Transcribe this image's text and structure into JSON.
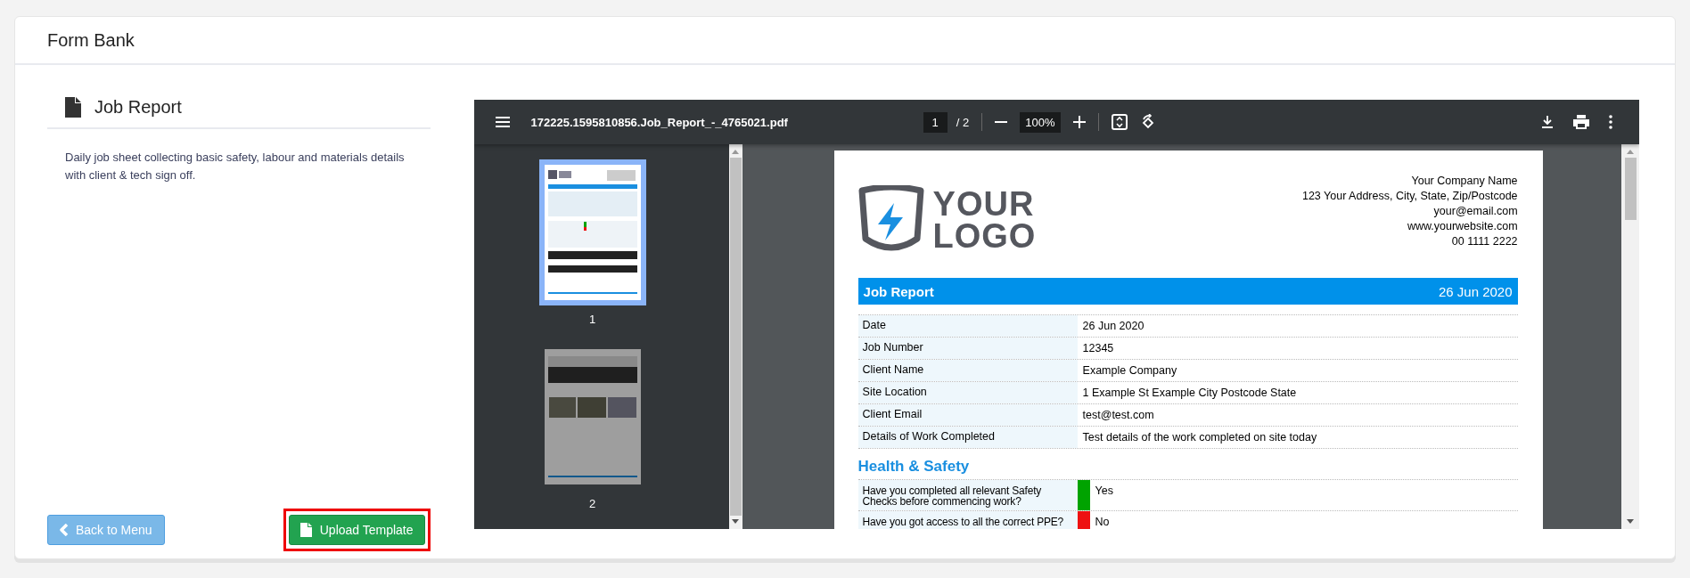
{
  "header": {
    "title": "Form Bank"
  },
  "form": {
    "title": "Job Report",
    "description": "Daily job sheet collecting basic safety, labour and materials details with client & tech sign off.",
    "back_button": "Back to Menu",
    "upload_button": {
      "label": "Upload Template",
      "highlighted": true
    }
  },
  "viewer": {
    "file_name": "172225.1595810856.Job_Report_-_4765021.pdf",
    "page_input": "1",
    "page_count": "/ 2",
    "zoom": "100%",
    "thumbnails": [
      {
        "label": "1",
        "selected": true
      },
      {
        "label": "2",
        "selected": false
      }
    ],
    "document": {
      "logo": {
        "line_1": "YOUR",
        "line_2": "LOGO"
      },
      "company_lines": [
        "Your Company Name",
        "123 Your Address, City, State, Zip/Postcode",
        "your@email.com",
        "www.yourwebsite.com",
        "00 1111 2222"
      ],
      "banner": {
        "title": "Job Report",
        "date": "26 Jun 2020"
      },
      "details": [
        {
          "label": "Date",
          "value": "26 Jun 2020"
        },
        {
          "label": "Job Number",
          "value": "12345"
        },
        {
          "label": "Client Name",
          "value": "Example Company"
        },
        {
          "label": "Site Location",
          "value": "1 Example St Example City Postcode State"
        },
        {
          "label": "Client Email",
          "value": "test@test.com"
        },
        {
          "label": "Details of Work Completed",
          "value": "Test details of the work completed on site today"
        }
      ],
      "section_title": "Health & Safety",
      "checks": [
        {
          "question": "Have you completed all relevant Safety Checks before commencing work?",
          "answer": "Yes",
          "color": "#00a300"
        },
        {
          "question": "Have you got access to all the correct PPE?",
          "answer": "No",
          "color": "#ee1111"
        }
      ]
    }
  }
}
